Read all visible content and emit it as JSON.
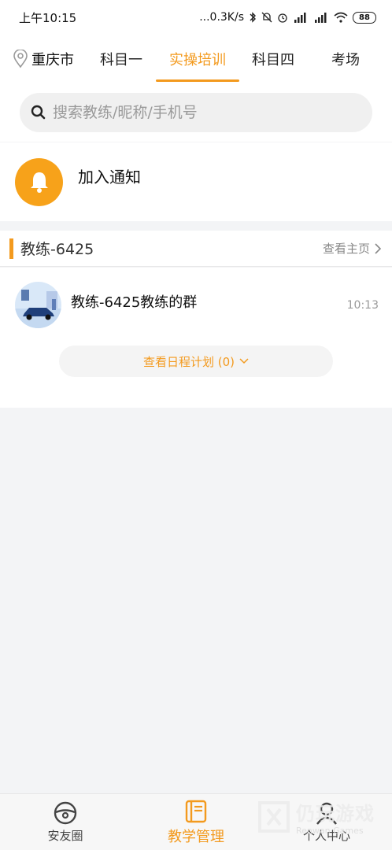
{
  "status_bar": {
    "time": "上午10:15",
    "network_speed": "...0.3K/s",
    "battery": "88"
  },
  "top_nav": {
    "city": "重庆市",
    "tabs": [
      {
        "label": "科目一",
        "active": false
      },
      {
        "label": "实操培训",
        "active": true
      },
      {
        "label": "科目四",
        "active": false
      },
      {
        "label": "考场",
        "active": false
      }
    ]
  },
  "search": {
    "placeholder": "搜索教练/昵称/手机号"
  },
  "notice": {
    "label": "加入通知"
  },
  "coach": {
    "name": "教练-6425",
    "home_link": "查看主页"
  },
  "group": {
    "name": "教练-6425教练的群",
    "time": "10:13",
    "schedule_button": "查看日程计划 (0)"
  },
  "bottom_nav": {
    "items": [
      {
        "label": "安友圈",
        "icon": "steering-wheel-icon",
        "active": false
      },
      {
        "label": "教学管理",
        "icon": "book-icon",
        "active": true
      },
      {
        "label": "个人中心",
        "icon": "person-icon",
        "active": false
      }
    ]
  },
  "watermark": {
    "cn": "仍玩游戏",
    "en": "Renwan Games"
  },
  "colors": {
    "accent": "#f39a1e",
    "bell": "#f7a21a",
    "background": "#f3f4f6"
  }
}
